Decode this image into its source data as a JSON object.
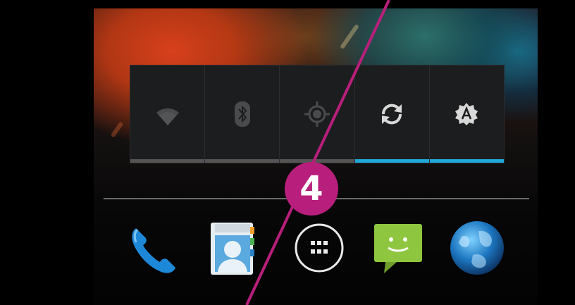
{
  "quick_settings": {
    "tiles": [
      {
        "name": "wifi",
        "icon": "wifi-icon",
        "state": "off"
      },
      {
        "name": "bluetooth",
        "icon": "bluetooth-icon",
        "state": "off"
      },
      {
        "name": "location",
        "icon": "gps-icon",
        "state": "off"
      },
      {
        "name": "sync",
        "icon": "sync-icon",
        "state": "on"
      },
      {
        "name": "auto-brightness",
        "icon": "brightness-auto-icon",
        "state": "on"
      }
    ],
    "active_color": "#20a8d8",
    "inactive_color": "#555555"
  },
  "dock": {
    "apps": [
      {
        "name": "phone",
        "icon": "phone-icon"
      },
      {
        "name": "contacts",
        "icon": "contacts-icon"
      },
      {
        "name": "app-drawer",
        "icon": "app-grid-icon"
      },
      {
        "name": "messaging",
        "icon": "message-icon"
      },
      {
        "name": "browser",
        "icon": "globe-icon"
      }
    ]
  },
  "annotation": {
    "step_number": "4",
    "color": "#b81f7c"
  }
}
